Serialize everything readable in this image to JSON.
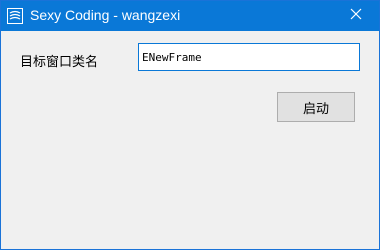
{
  "window": {
    "title": "Sexy Coding - wangzexi",
    "titlebar_color": "#0a78d7",
    "icon": "app-logo-icon",
    "close_icon": "close-icon"
  },
  "form": {
    "class_name_label": "目标窗口类名",
    "class_name_value": "ENewFrame",
    "start_button_label": "启动"
  }
}
